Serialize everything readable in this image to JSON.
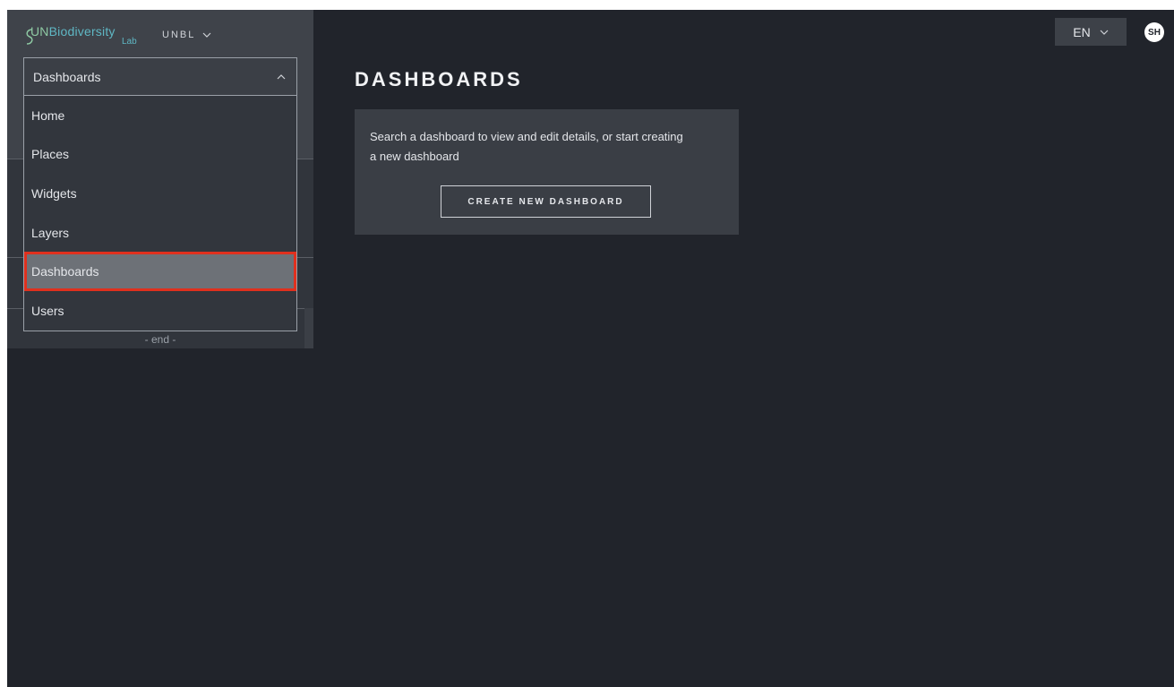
{
  "header": {
    "logo": {
      "brand": "UNBiodiversity",
      "brand_prefix": "UN",
      "brand_rest": "Biodiversity",
      "sub": "Lab"
    },
    "env_label": "UNBL",
    "language": "EN",
    "user_initials": "SH"
  },
  "nav": {
    "selected": "Dashboards",
    "items": [
      {
        "label": "Home"
      },
      {
        "label": "Places"
      },
      {
        "label": "Widgets"
      },
      {
        "label": "Layers"
      },
      {
        "label": "Dashboards"
      },
      {
        "label": "Users"
      }
    ],
    "end_label": "- end -"
  },
  "main": {
    "title": "DASHBOARDS",
    "card_text": "Search a dashboard to view and edit details, or start creating a new dashboard",
    "create_button": "CREATE NEW DASHBOARD"
  },
  "colors": {
    "background": "#21242b",
    "sidebar": "#31353c",
    "highlight": "#e0301e",
    "logo_teal": "#5fb7c4"
  }
}
